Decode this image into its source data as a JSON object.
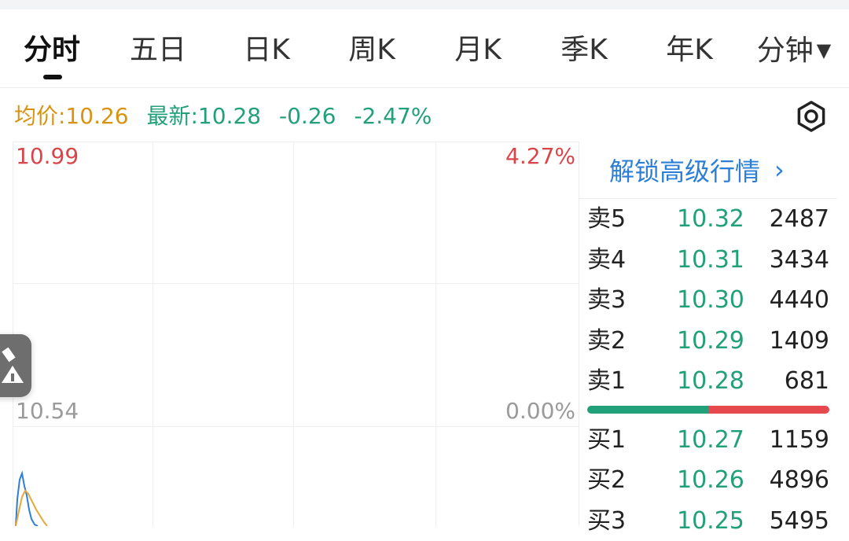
{
  "tabs": [
    {
      "label": "分时",
      "active": true
    },
    {
      "label": "五日"
    },
    {
      "label": "日K"
    },
    {
      "label": "周K"
    },
    {
      "label": "月K"
    },
    {
      "label": "季K"
    },
    {
      "label": "年K"
    },
    {
      "label": "分钟",
      "dropdown": true
    }
  ],
  "stats": {
    "avg": "均价:10.26",
    "latest": "最新:10.28",
    "change": "-0.26",
    "change_pct": "-2.47%"
  },
  "chart": {
    "y_high": "10.99",
    "pct_high": "4.27%",
    "y_mid": "10.54",
    "pct_mid": "0.00%"
  },
  "order_book": {
    "unlock_label": "解锁高级行情",
    "unlock_chevron": "›",
    "asks": [
      {
        "label": "卖5",
        "price": "10.32",
        "volume": "2487"
      },
      {
        "label": "卖4",
        "price": "10.31",
        "volume": "3434"
      },
      {
        "label": "卖3",
        "price": "10.30",
        "volume": "4440"
      },
      {
        "label": "卖2",
        "price": "10.29",
        "volume": "1409"
      },
      {
        "label": "卖1",
        "price": "10.28",
        "volume": "681"
      }
    ],
    "bids": [
      {
        "label": "买1",
        "price": "10.27",
        "volume": "1159"
      },
      {
        "label": "买2",
        "price": "10.26",
        "volume": "4896"
      },
      {
        "label": "买3",
        "price": "10.25",
        "volume": "5495"
      }
    ],
    "buy_ratio": 0.5
  },
  "colors": {
    "up": "#d9464a",
    "down": "#21a07a",
    "avg": "#d99312",
    "link": "#2d7fd6",
    "price_line": "#2d7fd6",
    "avg_line": "#e8a73a"
  },
  "icons": {
    "settings": "gear-icon",
    "tool": "pencil-icon",
    "dropdown": "caret-down-icon"
  }
}
